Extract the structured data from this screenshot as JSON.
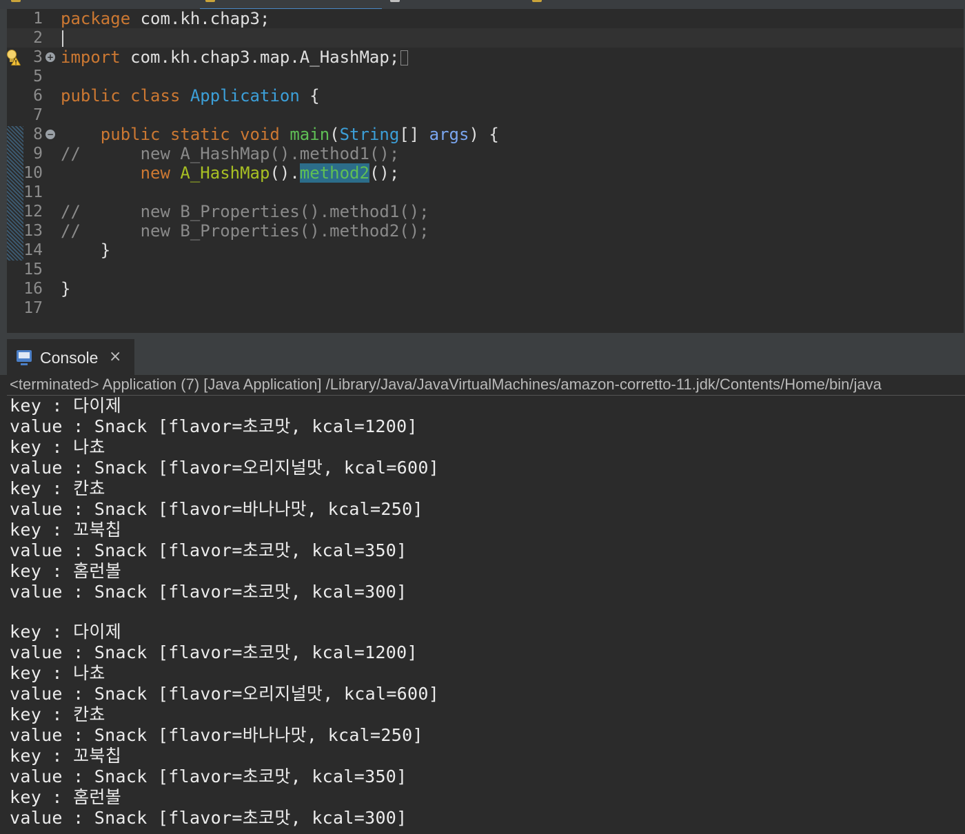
{
  "editor": {
    "lines": [
      {
        "n": "1",
        "tokens": [
          [
            "kw",
            "package"
          ],
          [
            "t",
            " com.kh.chap3;"
          ]
        ]
      },
      {
        "n": "2",
        "tokens": []
      },
      {
        "n": "3",
        "tokens": [
          [
            "kw",
            "import"
          ],
          [
            "t",
            " com.kh.chap3.map.A_HashMap;"
          ]
        ]
      },
      {
        "n": "5",
        "tokens": []
      },
      {
        "n": "6",
        "tokens": [
          [
            "kw",
            "public class "
          ],
          [
            "ty",
            "Application"
          ],
          [
            "t",
            " {"
          ]
        ]
      },
      {
        "n": "7",
        "tokens": []
      },
      {
        "n": "8",
        "tokens": [
          [
            "t",
            "    "
          ],
          [
            "kw",
            "public static void "
          ],
          [
            "fn",
            "main"
          ],
          [
            "t",
            "("
          ],
          [
            "ty",
            "String"
          ],
          [
            "t",
            "[] "
          ],
          [
            "arg",
            "args"
          ],
          [
            "t",
            ") {"
          ]
        ]
      },
      {
        "n": "9",
        "tokens": [
          [
            "cm",
            "//      new A_HashMap().method1();"
          ]
        ]
      },
      {
        "n": "10",
        "tokens": [
          [
            "t",
            "        "
          ],
          [
            "kw",
            "new "
          ],
          [
            "cls",
            "A_HashMap"
          ],
          [
            "t",
            "()."
          ],
          [
            "hl",
            "method2"
          ],
          [
            "t",
            "();"
          ]
        ]
      },
      {
        "n": "11",
        "tokens": []
      },
      {
        "n": "12",
        "tokens": [
          [
            "cm",
            "//      new B_Properties().method1();"
          ]
        ]
      },
      {
        "n": "13",
        "tokens": [
          [
            "cm",
            "//      new B_Properties().method2();"
          ]
        ]
      },
      {
        "n": "14",
        "tokens": [
          [
            "t",
            "    }"
          ]
        ]
      },
      {
        "n": "15",
        "tokens": []
      },
      {
        "n": "16",
        "tokens": [
          [
            "t",
            "}"
          ]
        ]
      },
      {
        "n": "17",
        "tokens": []
      }
    ]
  },
  "console": {
    "title": "Console",
    "close_icon": "×",
    "status": "<terminated> Application (7) [Java Application] /Library/Java/JavaVirtualMachines/amazon-corretto-11.jdk/Contents/Home/bin/java",
    "output": [
      "key : 다이제",
      "value : Snack [flavor=초코맛, kcal=1200]",
      "key : 나쵸",
      "value : Snack [flavor=오리지널맛, kcal=600]",
      "key : 칸쵸",
      "value : Snack [flavor=바나나맛, kcal=250]",
      "key : 꼬북칩",
      "value : Snack [flavor=초코맛, kcal=350]",
      "key : 홈런볼",
      "value : Snack [flavor=초코맛, kcal=300]",
      "",
      "key : 다이제",
      "value : Snack [flavor=초코맛, kcal=1200]",
      "key : 나쵸",
      "value : Snack [flavor=오리지널맛, kcal=600]",
      "key : 칸쵸",
      "value : Snack [flavor=바나나맛, kcal=250]",
      "key : 꼬북칩",
      "value : Snack [flavor=초코맛, kcal=350]",
      "key : 홈런볼",
      "value : Snack [flavor=초코맛, kcal=300]"
    ]
  },
  "icons": {
    "tab_file": "java-file-icon",
    "warning": "lightbulb-warning-icon",
    "console": "console-icon",
    "close": "close-icon",
    "expand": "fold-expand-icon",
    "collapse": "fold-collapse-icon"
  }
}
